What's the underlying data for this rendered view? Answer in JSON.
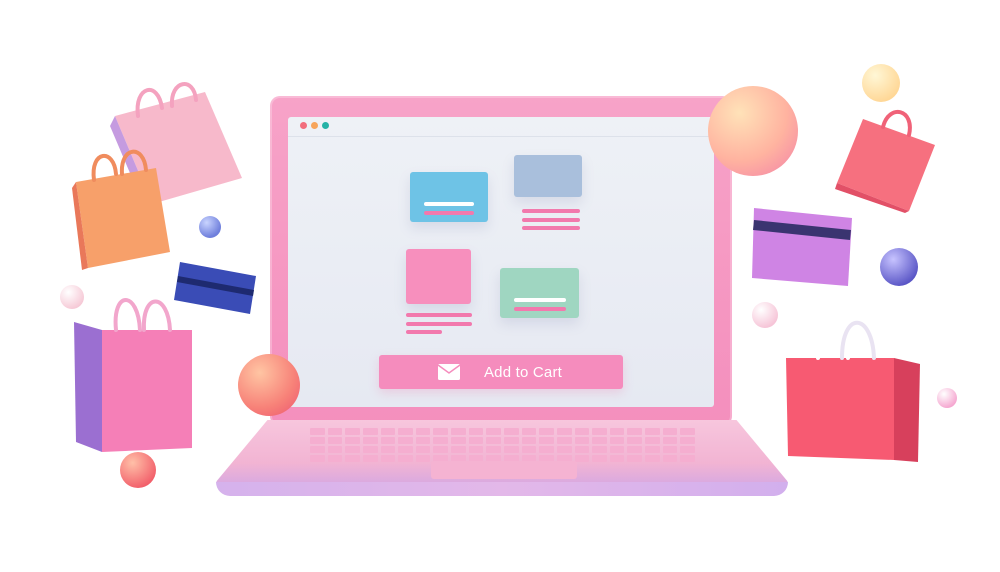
{
  "screen": {
    "cart_button_label": "Add to Cart"
  },
  "icons": {
    "cart_button_icon": "envelope-icon"
  },
  "colors": {
    "laptop_lid": "#f48fbd",
    "screen_bg": "#e9ecf4",
    "button": "#f58cbd",
    "accent_pink": "#f279ad",
    "accent_blue": "#6ec3e6",
    "accent_green": "#9fd6c1",
    "accent_purple": "#cfa5e5"
  }
}
